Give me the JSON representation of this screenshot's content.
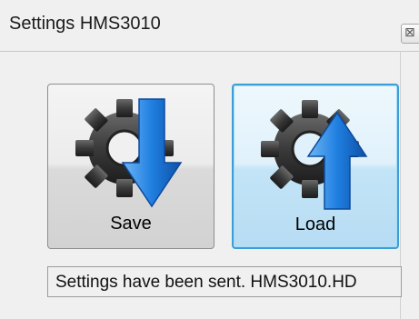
{
  "window": {
    "title": "Settings HMS3010",
    "close_glyph": "⊠"
  },
  "buttons": {
    "save_label": "Save",
    "load_label": "Load",
    "save_icon": "gear-arrow-down-icon",
    "load_icon": "gear-arrow-up-icon"
  },
  "status": {
    "text": "Settings have been sent. HMS3010.HD"
  },
  "colors": {
    "focus_border": "#3c9ed6",
    "arrow_blue": "#1f7fe0",
    "gear_dark": "#3a3a3a"
  }
}
